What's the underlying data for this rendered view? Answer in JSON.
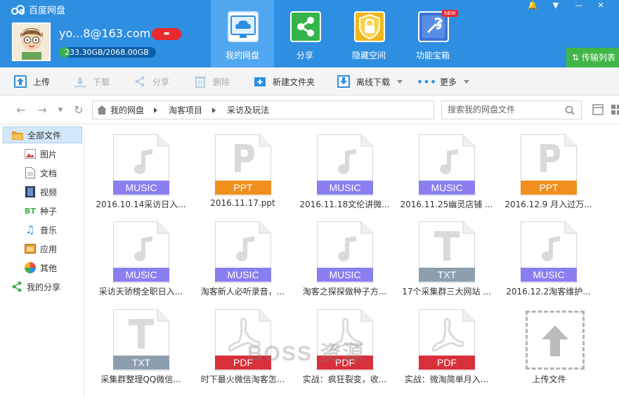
{
  "app": {
    "title": "百度网盘"
  },
  "user": {
    "name": "yo...8@163.com",
    "quota_text": "233.30GB/2068.00GB",
    "quota_used_gb": 233.3,
    "quota_total_gb": 2068.0
  },
  "nav_tabs": [
    {
      "label": "我的网盘",
      "icon": "cloud-drive-icon",
      "active": true
    },
    {
      "label": "分享",
      "icon": "share-icon",
      "active": false
    },
    {
      "label": "隐藏空间",
      "icon": "lock-icon",
      "active": false
    },
    {
      "label": "功能宝箱",
      "icon": "toolbox-icon",
      "active": false,
      "badge": "NEW"
    }
  ],
  "transfer_label": "传输列表",
  "toolbar": {
    "upload": "上传",
    "download": "下载",
    "share": "分享",
    "delete": "删除",
    "new_folder": "新建文件夹",
    "offline_download": "离线下载",
    "more": "更多"
  },
  "breadcrumb": [
    "我的网盘",
    "淘客项目",
    "采访及玩法"
  ],
  "search": {
    "placeholder": "搜索我的网盘文件"
  },
  "sidebar": [
    {
      "label": "全部文件",
      "icon": "folder-icon",
      "active": true
    },
    {
      "label": "图片",
      "icon": "image-icon"
    },
    {
      "label": "文档",
      "icon": "document-icon"
    },
    {
      "label": "视频",
      "icon": "video-icon"
    },
    {
      "label": "种子",
      "icon": "bt-icon"
    },
    {
      "label": "音乐",
      "icon": "music-icon"
    },
    {
      "label": "应用",
      "icon": "app-icon"
    },
    {
      "label": "其他",
      "icon": "other-icon"
    },
    {
      "label": "我的分享",
      "icon": "share-icon"
    }
  ],
  "files": [
    {
      "name": "2016.10.14采访日入...",
      "type": "MUSIC"
    },
    {
      "name": "2016.11.17.ppt",
      "type": "PPT"
    },
    {
      "name": "2016.11.18文伦讲微...",
      "type": "MUSIC"
    },
    {
      "name": "2016.11.25幽灵店铺 ...",
      "type": "MUSIC"
    },
    {
      "name": "2016.12.9 月入过万...",
      "type": "PPT"
    },
    {
      "name": "采访天骄榜全职日入...",
      "type": "MUSIC"
    },
    {
      "name": "淘客新人必听录音，...",
      "type": "MUSIC"
    },
    {
      "name": "淘客之探探做种子方...",
      "type": "MUSIC"
    },
    {
      "name": "17个采集群三大网站 ...",
      "type": "TXT"
    },
    {
      "name": "2016.12.2淘客维护...",
      "type": "MUSIC"
    },
    {
      "name": "采集群整理QQ微信...",
      "type": "TXT"
    },
    {
      "name": "时下最火微信淘客怎...",
      "type": "PDF"
    },
    {
      "name": "实战：疯狂裂变，收...",
      "type": "PDF"
    },
    {
      "name": "实战：微淘简单月入...",
      "type": "PDF"
    }
  ],
  "upload_tile": {
    "label": "上传文件"
  },
  "watermark": "BOSS 资源",
  "colors": {
    "header": "#2e8fe1",
    "music": "#8a7ff0",
    "ppt": "#ef8f1e",
    "txt": "#8d9fae",
    "pdf": "#d7303a",
    "transfer": "#41b648"
  }
}
